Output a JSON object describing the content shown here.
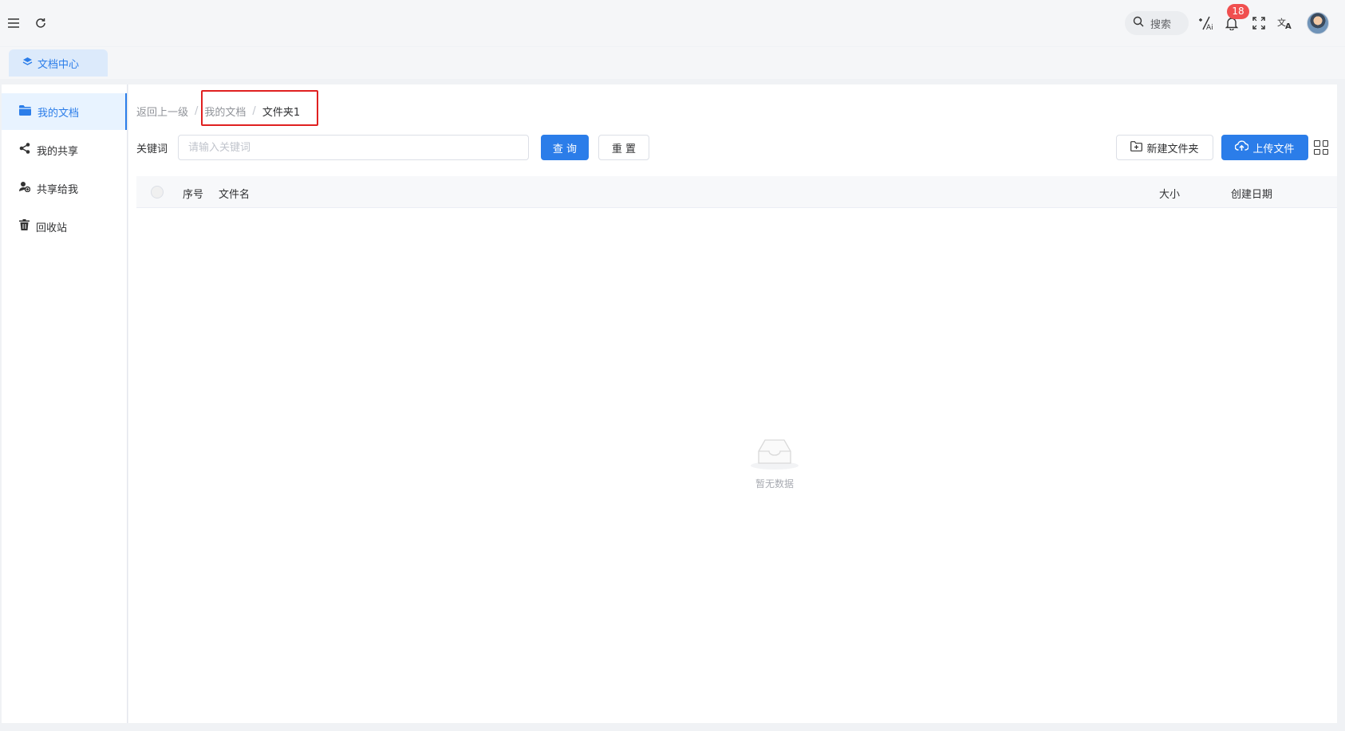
{
  "header": {
    "search_label": "搜索",
    "notification_count": "18"
  },
  "tabs": [
    {
      "label": "文档中心"
    }
  ],
  "sidebar": {
    "items": [
      {
        "label": "我的文档",
        "icon": "folder-icon",
        "active": true
      },
      {
        "label": "我的共享",
        "icon": "share-icon",
        "active": false
      },
      {
        "label": "共享给我",
        "icon": "shared-with-me-icon",
        "active": false
      },
      {
        "label": "回收站",
        "icon": "trash-icon",
        "active": false
      }
    ]
  },
  "breadcrumb": {
    "back": "返回上一级",
    "separator": "/",
    "items": [
      "我的文档",
      "文件夹1"
    ]
  },
  "filter": {
    "keyword_label": "关键词",
    "keyword_placeholder": "请输入关键词",
    "keyword_value": "",
    "search_button": "查 询",
    "reset_button": "重 置"
  },
  "actions": {
    "new_folder": "新建文件夹",
    "upload": "上传文件"
  },
  "table": {
    "columns": [
      "序号",
      "文件名",
      "大小",
      "创建日期"
    ],
    "rows": [],
    "empty_text": "暂无数据"
  },
  "colors": {
    "primary": "#2b7de9",
    "badge": "#f04f4f",
    "highlight_box": "#e02020"
  }
}
